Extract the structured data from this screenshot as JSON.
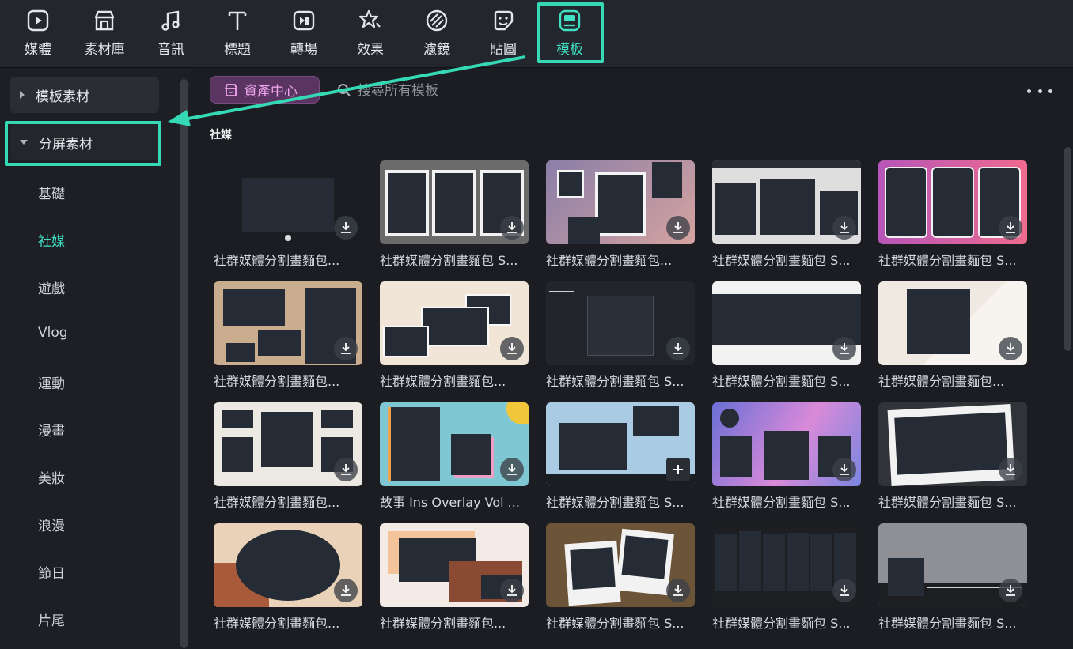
{
  "toolbar": {
    "items": [
      {
        "label": "媒體",
        "icon": "media-icon"
      },
      {
        "label": "素材庫",
        "icon": "stock-icon"
      },
      {
        "label": "音訊",
        "icon": "music-note-icon"
      },
      {
        "label": "標題",
        "icon": "text-icon"
      },
      {
        "label": "轉場",
        "icon": "transition-icon"
      },
      {
        "label": "效果",
        "icon": "effects-icon"
      },
      {
        "label": "濾鏡",
        "icon": "filter-icon"
      },
      {
        "label": "貼圖",
        "icon": "sticker-icon"
      },
      {
        "label": "模板",
        "icon": "template-icon"
      }
    ],
    "active": "模板"
  },
  "sidebar": {
    "groups": [
      {
        "label": "模板素材",
        "expanded": false
      },
      {
        "label": "分屏素材",
        "expanded": true
      }
    ],
    "items": [
      "基礎",
      "社媒",
      "遊戲",
      "Vlog",
      "運動",
      "漫畫",
      "美妝",
      "浪漫",
      "節日",
      "片尾"
    ],
    "active": "社媒"
  },
  "main": {
    "asset_button": "資產中心",
    "search_placeholder": "搜尋所有模板",
    "section_title": "社媒",
    "cards": [
      {
        "title": "社群媒體分割畫麵包...",
        "bg": "#1a1d22",
        "action": "download"
      },
      {
        "title": "社群媒體分割畫麵包 S...",
        "bg": "#6b6b6b",
        "action": "download"
      },
      {
        "title": "社群媒體分割畫麵包...",
        "bg": "#b28c9c",
        "action": "download"
      },
      {
        "title": "社群媒體分割畫麵包 S...",
        "bg": "#dedede",
        "action": "download"
      },
      {
        "title": "社群媒體分割畫麵包 S...",
        "bg": "#d85a9e",
        "action": "download"
      },
      {
        "title": "社群媒體分割畫麵包...",
        "bg": "#c9ad8e",
        "action": "download"
      },
      {
        "title": "社群媒體分割畫麵包...",
        "bg": "#f0e5d6",
        "action": "download"
      },
      {
        "title": "社群媒體分割畫麵包 S...",
        "bg": "#22262c",
        "action": "download"
      },
      {
        "title": "社群媒體分割畫麵包 S...",
        "bg": "#f2f2f2",
        "action": "download"
      },
      {
        "title": "社群媒體分割畫麵包...",
        "bg": "#efe9e2",
        "action": "download"
      },
      {
        "title": "社群媒體分割畫麵包...",
        "bg": "#ece8e2",
        "action": "download"
      },
      {
        "title": "故事 Ins Overlay Vol ...",
        "bg": "#7fc7d3",
        "action": "download"
      },
      {
        "title": "社群媒體分割畫麵包 S...",
        "bg": "#a9cbe4",
        "action": "add"
      },
      {
        "title": "社群媒體分割畫麵包 S...",
        "bg": "#b48ae0",
        "action": "download"
      },
      {
        "title": "社群媒體分割畫麵包 S...",
        "bg": "#303338",
        "action": "download"
      },
      {
        "title": "社群媒體分割畫麵包...",
        "bg": "#ead2b8",
        "action": "download"
      },
      {
        "title": "社群媒體分割畫麵包...",
        "bg": "#f4ebe6",
        "action": "download"
      },
      {
        "title": "社群媒體分割畫麵包 S...",
        "bg": "#6b5438",
        "action": "download"
      },
      {
        "title": "社群媒體分割畫麵包 S...",
        "bg": "#1c1e22",
        "action": "download"
      },
      {
        "title": "社群媒體分割畫麵包 S...",
        "bg": "#8e9096",
        "action": "download"
      }
    ]
  },
  "colors": {
    "accent": "#3fe0c4",
    "highlight": "#35d9b5",
    "asset_button_bg": "#5a3561",
    "asset_button_text": "#f0a6ee"
  }
}
